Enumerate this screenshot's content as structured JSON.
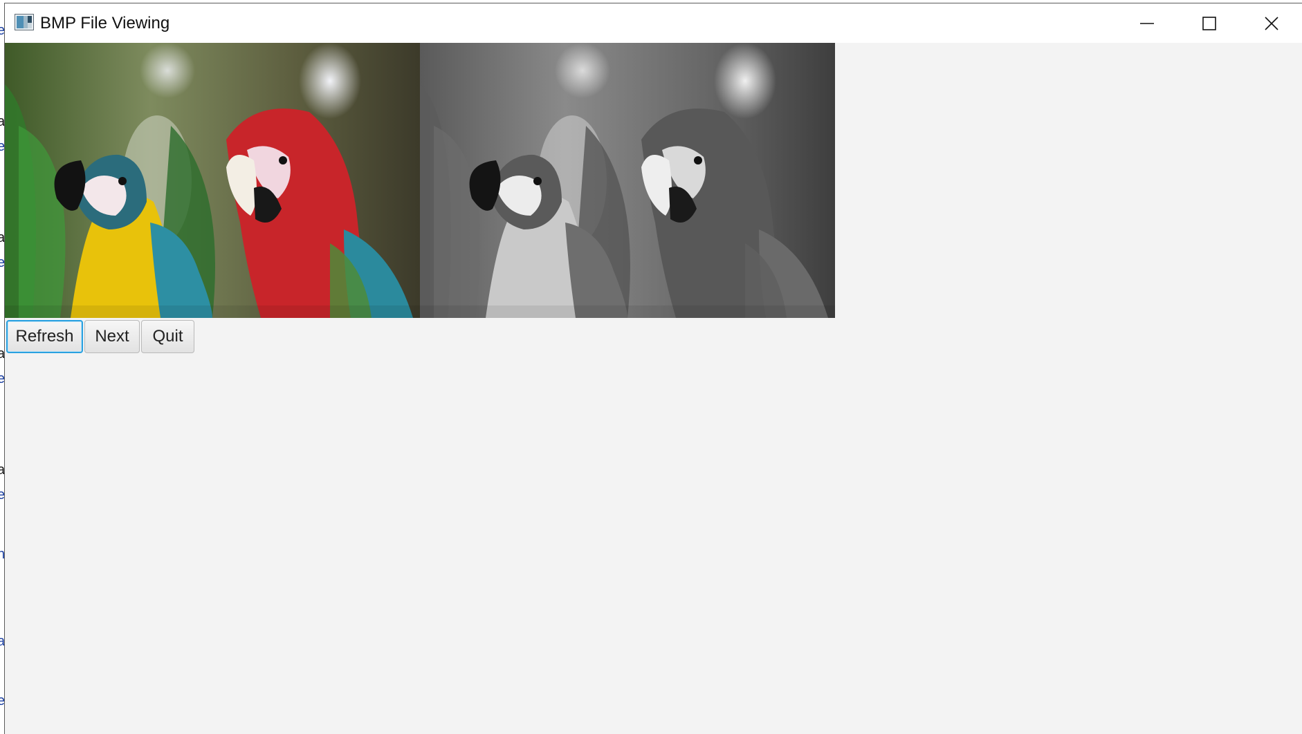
{
  "window": {
    "title": "BMP File Viewing"
  },
  "images": [
    {
      "name": "color-parrots",
      "kind": "original color image of two macaws"
    },
    {
      "name": "grayscale-parrots",
      "kind": "grayscale version of the same image"
    }
  ],
  "buttons": {
    "refresh": "Refresh",
    "next": "Next",
    "quit": "Quit"
  },
  "colors": {
    "focus_border": "#2aa1e0",
    "window_bg": "#f3f3f3",
    "titlebar_bg": "#ffffff"
  },
  "icons": {
    "app": "app-image-icon",
    "minimize": "minimize-icon",
    "maximize": "maximize-icon",
    "close": "close-icon"
  }
}
